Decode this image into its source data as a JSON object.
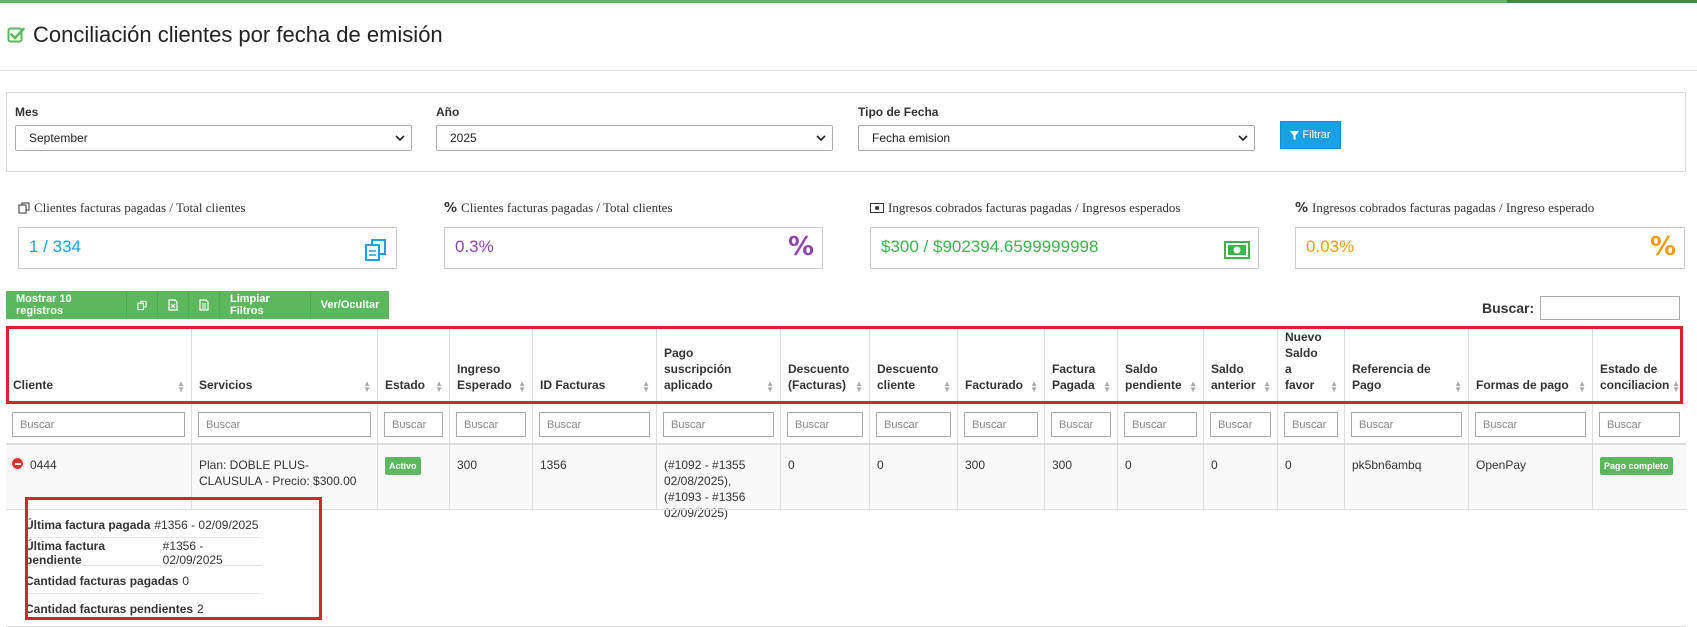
{
  "page": {
    "title": "Conciliación clientes por fecha de emisión"
  },
  "filters": {
    "mes": {
      "label": "Mes",
      "value": "September"
    },
    "anio": {
      "label": "Año",
      "value": "2025"
    },
    "tipo_fecha": {
      "label": "Tipo de Fecha",
      "value": "Fecha emision"
    },
    "button": "Filtrar"
  },
  "stats": [
    {
      "label": "Clientes facturas pagadas / Total clientes",
      "value": "1 / 334",
      "color": "#1ba1e2",
      "icon": "copy-icon"
    },
    {
      "label": "Clientes facturas pagadas / Total clientes",
      "value": "0.3%",
      "color": "#8e44ad",
      "icon": "percent-icon"
    },
    {
      "label": "Ingresos cobrados facturas pagadas / Ingresos esperados",
      "value": "$300 / $902394.6599999998",
      "color": "#3cb44b",
      "icon": "money-icon"
    },
    {
      "label": "Ingresos cobrados facturas pagadas / Ingreso esperado",
      "value": "0.03%",
      "color": "#f39c12",
      "icon": "percent-icon"
    }
  ],
  "toolbar": {
    "show": "Mostrar 10 registros",
    "clear": "Limpiar Filtros",
    "toggle": "Ver/Ocultar",
    "search_label": "Buscar:"
  },
  "table": {
    "filter_placeholder": "Buscar",
    "columns": [
      "Cliente",
      "Servicios",
      "Estado",
      "Ingreso Esperado",
      "ID Facturas",
      "Pago suscripción aplicado",
      "Descuento (Facturas)",
      "Descuento cliente",
      "Facturado",
      "Factura Pagada",
      "Saldo pendiente",
      "Saldo anterior",
      "Nuevo Saldo a favor",
      "Referencia de Pago",
      "Formas de pago",
      "Estado de conciliacion"
    ],
    "row": {
      "cliente": "0444",
      "servicios": "Plan: DOBLE PLUS-CLAUSULA - Precio: $300.00",
      "estado": "Activo",
      "ingreso": "300",
      "id_facturas": "1356",
      "pago": "(#1092 - #1355 02/08/2025), (#1093 - #1356 02/09/2025)",
      "desc_facturas": "0",
      "desc_cliente": "0",
      "facturado": "300",
      "factura_pagada": "300",
      "saldo_pendiente": "0",
      "saldo_anterior": "0",
      "nuevo_saldo": "0",
      "referencia": "pk5bn6ambq",
      "formas": "OpenPay",
      "conciliacion": "Pago completo"
    }
  },
  "details": [
    {
      "label": "Última factura pagada",
      "value": "#1356 - 02/09/2025"
    },
    {
      "label": "Última factura pendiente",
      "value": "#1356 - 02/09/2025"
    },
    {
      "label": "Cantidad facturas pagadas",
      "value": "0"
    },
    {
      "label": "Cantidad facturas pendientes",
      "value": "2"
    }
  ]
}
